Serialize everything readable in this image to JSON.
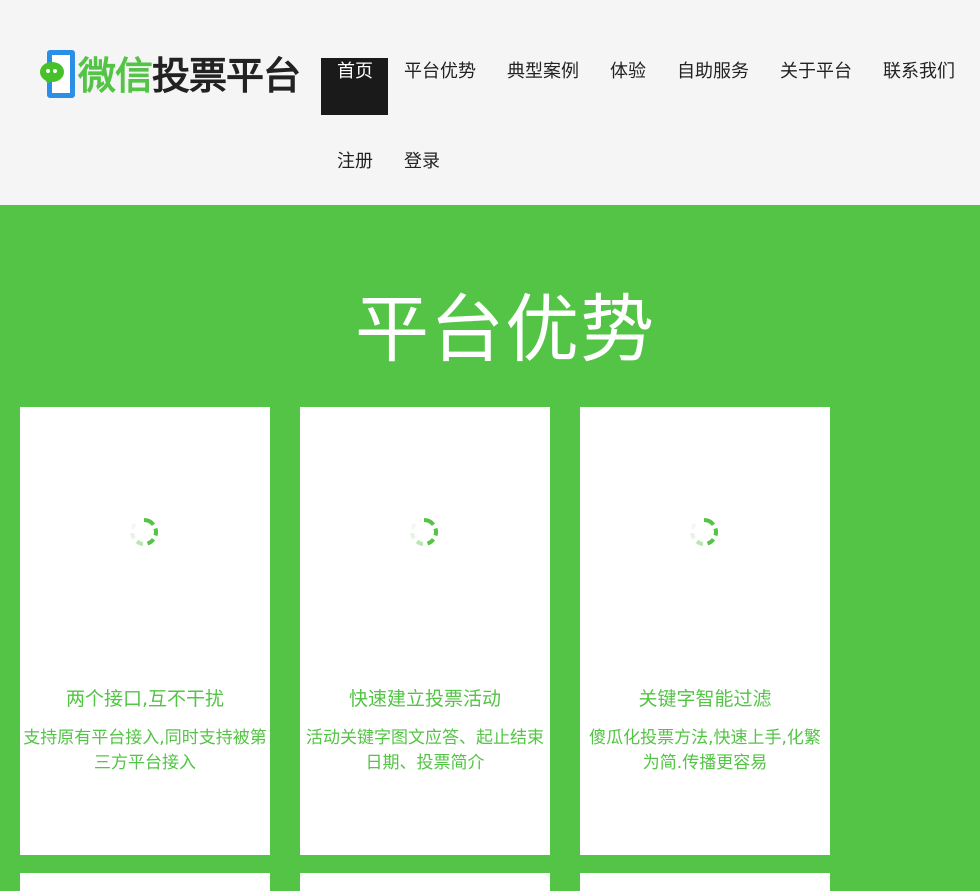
{
  "logo": {
    "green_text": "微信",
    "dark_text": "投票平台"
  },
  "nav": {
    "items": [
      {
        "label": "首页",
        "active": true
      },
      {
        "label": "平台优势"
      },
      {
        "label": "典型案例"
      },
      {
        "label": "体验"
      },
      {
        "label": "自助服务"
      },
      {
        "label": "关于平台"
      },
      {
        "label": "联系我们"
      },
      {
        "label": "注册"
      },
      {
        "label": "登录"
      }
    ]
  },
  "section": {
    "title": "平台优势"
  },
  "cards": [
    {
      "title": "两个接口,互不干扰",
      "desc": "支持原有平台接入,同时支持被第三方平台接入"
    },
    {
      "title": "快速建立投票活动",
      "desc": "活动关键字图文应答、起止结束日期、投票简介"
    },
    {
      "title": "关键字智能过滤",
      "desc": "傻瓜化投票方法,快速上手,化繁为简.传播更容易"
    }
  ],
  "colors": {
    "brand_green": "#53c445",
    "logo_blue": "#2b8fe8",
    "header_bg": "#f5f5f5",
    "active_nav_bg": "#1a1a1a"
  }
}
